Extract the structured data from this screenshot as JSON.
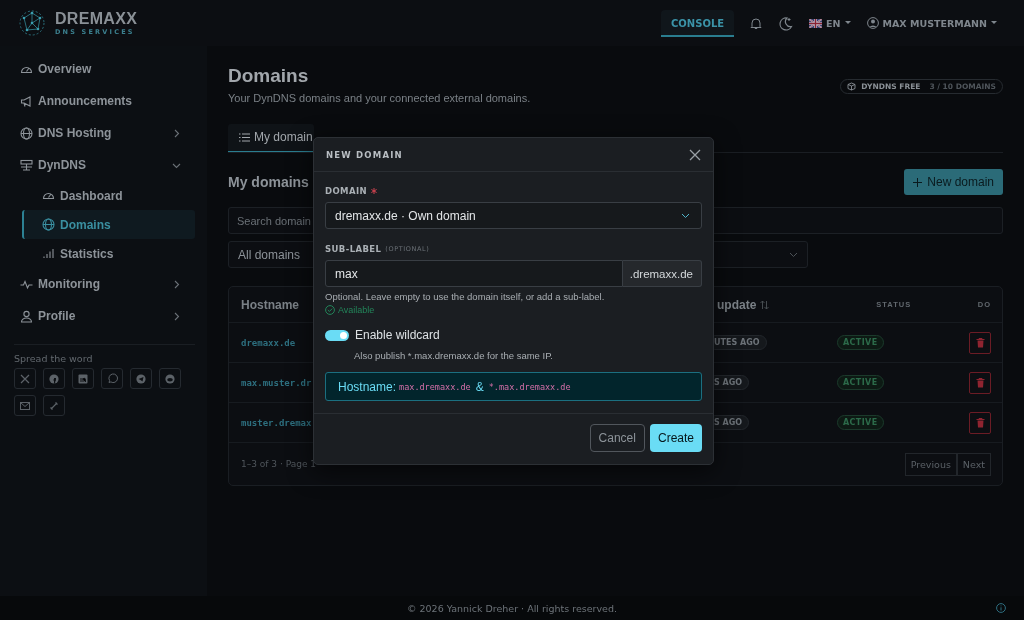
{
  "header": {
    "logo": {
      "name": "DREMAXX",
      "tagline": "DNS SERVICES"
    },
    "nav": [
      {
        "label": "CONSOLE",
        "selected": true
      }
    ],
    "language": "EN",
    "user": "MAX MUSTERMANN"
  },
  "sidebar": {
    "items": [
      {
        "label": "Overview",
        "selected": false
      },
      {
        "label": "Announcements",
        "selected": false
      },
      {
        "label": "DNS Hosting",
        "selected": false,
        "expanded": false
      },
      {
        "label": "DynDNS",
        "selected": false,
        "expanded": true,
        "children": [
          {
            "label": "Dashboard",
            "selected": false
          },
          {
            "label": "Domains",
            "selected": true
          },
          {
            "label": "Statistics",
            "selected": false
          }
        ]
      },
      {
        "label": "Monitoring",
        "selected": false,
        "expanded": false
      },
      {
        "label": "Profile",
        "selected": false,
        "expanded": false
      }
    ],
    "share_title": "Spread the word"
  },
  "page": {
    "title": "Domains",
    "subtitle": "Your DynDNS domains and your connected external domains.",
    "plan": {
      "name": "DYNDNS FREE",
      "usage": "3 / 10 DOMAINS"
    },
    "tabs": [
      {
        "label": "My domain",
        "selected": true
      }
    ],
    "section_title": "My domains",
    "new_button": "New domain",
    "search": {
      "placeholder": "Search domain"
    },
    "filter": {
      "value": "All domains"
    },
    "table": {
      "columns": [
        "Hostname",
        "update",
        "STATUS",
        "DO"
      ],
      "rows": [
        {
          "hostname": "dremaxx.de",
          "last_update": "UTES AGO",
          "status": "ACTIVE"
        },
        {
          "hostname": "max.muster.dr",
          "last_update": "S AGO",
          "status": "ACTIVE"
        },
        {
          "hostname": "muster.dremax",
          "last_update": "S AGO",
          "status": "ACTIVE"
        }
      ],
      "summary": "1–3 of 3 · Page 1",
      "pager": [
        {
          "label": "Previous",
          "disabled": true
        },
        {
          "label": "Next",
          "disabled": true
        }
      ]
    }
  },
  "modal": {
    "title": "NEW DOMAIN",
    "domain": {
      "label": "DOMAIN",
      "required": true,
      "value": "dremaxx.de · Own domain"
    },
    "sublabel": {
      "label": "SUB-LABEL",
      "hint": "(OPTIONAL)",
      "value": "max",
      "suffix": ".dremaxx.de",
      "help": "Optional. Leave empty to use the domain itself, or add a sub-label.",
      "availability": "Available"
    },
    "wildcard": {
      "label": "Enable wildcard",
      "on": true,
      "help": "Also publish *.max.dremaxx.de for the same IP."
    },
    "preview": {
      "label": "Hostname:",
      "names": [
        "max.dremaxx.de",
        "*.max.dremaxx.de"
      ],
      "joiner": "&"
    },
    "buttons": {
      "cancel": "Cancel",
      "create": "Create"
    }
  },
  "footer": {
    "text": "© 2026 Yannick Dreher · All rights reserved."
  }
}
